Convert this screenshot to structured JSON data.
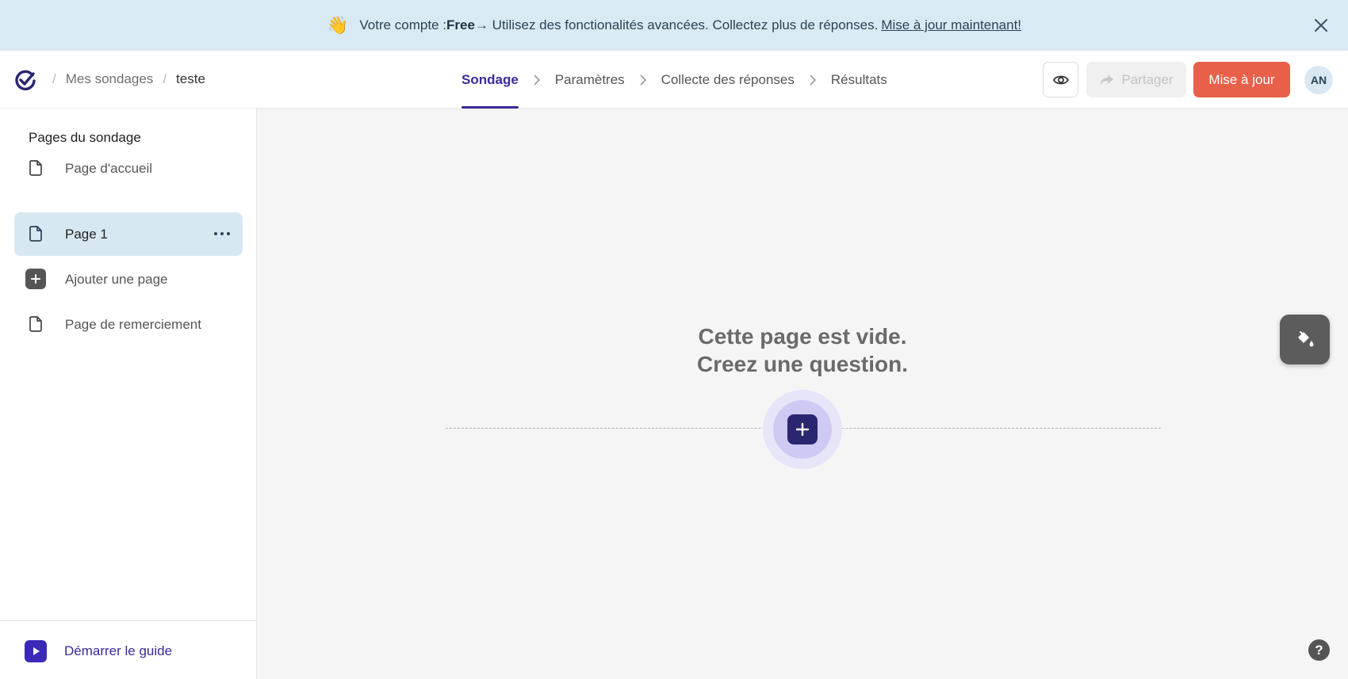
{
  "banner": {
    "emoji": "👋",
    "prefix": "Votre compte : ",
    "plan": "Free",
    "message": " → Utilisez des fonctionalités avancées. Collectez plus de réponses.",
    "link": "Mise à jour maintenant!"
  },
  "header": {
    "breadcrumb": [
      "Mes sondages",
      "teste"
    ],
    "steps": [
      "Sondage",
      "Paramètres",
      "Collecte des réponses",
      "Résultats"
    ],
    "active_step": "Sondage",
    "share_label": "Partager",
    "upgrade_label": "Mise à jour",
    "avatar_initials": "AN"
  },
  "sidebar": {
    "title": "Pages du sondage",
    "items": [
      {
        "label": "Page d'accueil",
        "icon": "page-icon"
      },
      {
        "label": "Page 1",
        "icon": "page-icon",
        "selected": true
      },
      {
        "label": "Ajouter une page",
        "icon": "plus-icon"
      },
      {
        "label": "Page de remerciement",
        "icon": "page-icon"
      }
    ],
    "guide_label": "Démarrer le guide"
  },
  "canvas": {
    "empty_line1": "Cette page est vide.",
    "empty_line2": "Creez une question."
  },
  "help_label": "?",
  "colors": {
    "accent": "#3b2a96",
    "upgrade": "#e9604a",
    "banner_bg": "#daeaf4",
    "selected_bg": "#d8e8f3"
  }
}
